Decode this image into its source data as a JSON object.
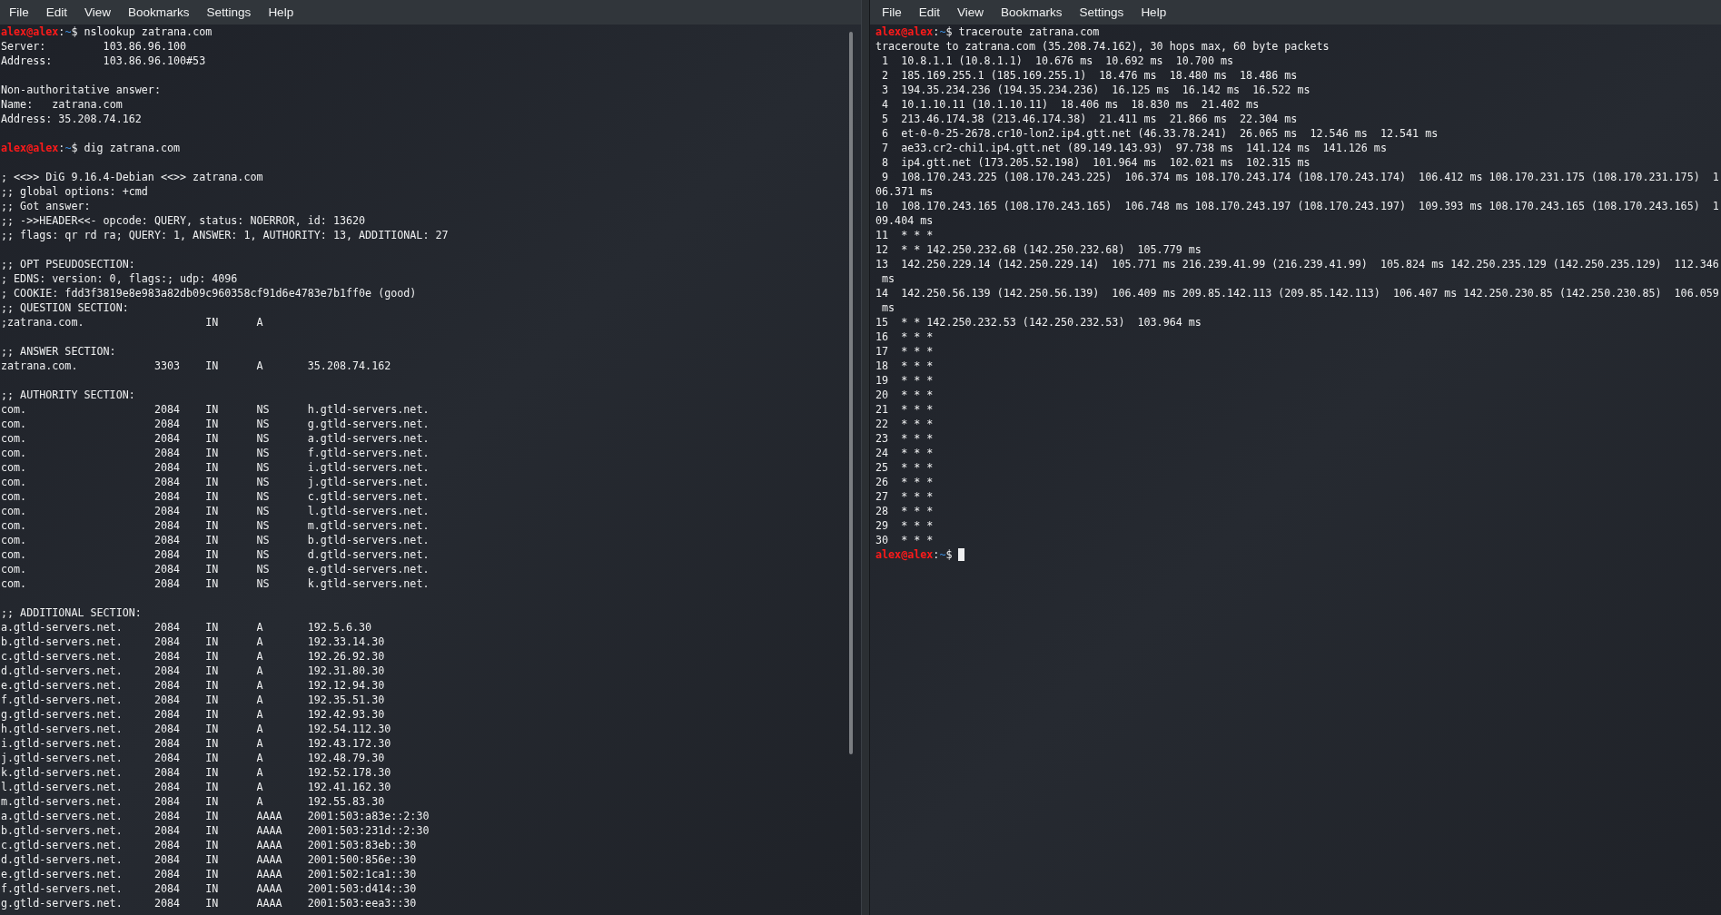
{
  "terminals": [
    {
      "menu": [
        "File",
        "Edit",
        "View",
        "Bookmarks",
        "Settings",
        "Help"
      ],
      "lines": [
        {
          "kind": "prompt",
          "user": "alex@alex",
          "sep": ":",
          "path": "~",
          "sign": "$",
          "command": " nslookup zatrana.com"
        },
        {
          "kind": "output",
          "text": "Server:\t\t103.86.96.100"
        },
        {
          "kind": "output",
          "text": "Address:\t103.86.96.100#53"
        },
        {
          "kind": "blank"
        },
        {
          "kind": "output",
          "text": "Non-authoritative answer:"
        },
        {
          "kind": "output",
          "text": "Name:\tzatrana.com"
        },
        {
          "kind": "output",
          "text": "Address: 35.208.74.162"
        },
        {
          "kind": "blank"
        },
        {
          "kind": "prompt",
          "user": "alex@alex",
          "sep": ":",
          "path": "~",
          "sign": "$",
          "command": " dig zatrana.com"
        },
        {
          "kind": "blank"
        },
        {
          "kind": "output",
          "text": "; <<>> DiG 9.16.4-Debian <<>> zatrana.com"
        },
        {
          "kind": "output",
          "text": ";; global options: +cmd"
        },
        {
          "kind": "output",
          "text": ";; Got answer:"
        },
        {
          "kind": "output",
          "text": ";; ->>HEADER<<- opcode: QUERY, status: NOERROR, id: 13620"
        },
        {
          "kind": "output",
          "text": ";; flags: qr rd ra; QUERY: 1, ANSWER: 1, AUTHORITY: 13, ADDITIONAL: 27"
        },
        {
          "kind": "blank"
        },
        {
          "kind": "output",
          "text": ";; OPT PSEUDOSECTION:"
        },
        {
          "kind": "output",
          "text": "; EDNS: version: 0, flags:; udp: 4096"
        },
        {
          "kind": "output",
          "text": "; COOKIE: fdd3f3819e8e983a82db09c960358cf91d6e4783e7b1ff0e (good)"
        },
        {
          "kind": "output",
          "text": ";; QUESTION SECTION:"
        },
        {
          "kind": "output",
          "text": ";zatrana.com.\t\t\tIN\tA"
        },
        {
          "kind": "blank"
        },
        {
          "kind": "output",
          "text": ";; ANSWER SECTION:"
        },
        {
          "kind": "output",
          "text": "zatrana.com.\t\t3303\tIN\tA\t35.208.74.162"
        },
        {
          "kind": "blank"
        },
        {
          "kind": "output",
          "text": ";; AUTHORITY SECTION:"
        },
        {
          "kind": "output",
          "text": "com.\t\t\t2084\tIN\tNS\th.gtld-servers.net."
        },
        {
          "kind": "output",
          "text": "com.\t\t\t2084\tIN\tNS\tg.gtld-servers.net."
        },
        {
          "kind": "output",
          "text": "com.\t\t\t2084\tIN\tNS\ta.gtld-servers.net."
        },
        {
          "kind": "output",
          "text": "com.\t\t\t2084\tIN\tNS\tf.gtld-servers.net."
        },
        {
          "kind": "output",
          "text": "com.\t\t\t2084\tIN\tNS\ti.gtld-servers.net."
        },
        {
          "kind": "output",
          "text": "com.\t\t\t2084\tIN\tNS\tj.gtld-servers.net."
        },
        {
          "kind": "output",
          "text": "com.\t\t\t2084\tIN\tNS\tc.gtld-servers.net."
        },
        {
          "kind": "output",
          "text": "com.\t\t\t2084\tIN\tNS\tl.gtld-servers.net."
        },
        {
          "kind": "output",
          "text": "com.\t\t\t2084\tIN\tNS\tm.gtld-servers.net."
        },
        {
          "kind": "output",
          "text": "com.\t\t\t2084\tIN\tNS\tb.gtld-servers.net."
        },
        {
          "kind": "output",
          "text": "com.\t\t\t2084\tIN\tNS\td.gtld-servers.net."
        },
        {
          "kind": "output",
          "text": "com.\t\t\t2084\tIN\tNS\te.gtld-servers.net."
        },
        {
          "kind": "output",
          "text": "com.\t\t\t2084\tIN\tNS\tk.gtld-servers.net."
        },
        {
          "kind": "blank"
        },
        {
          "kind": "output",
          "text": ";; ADDITIONAL SECTION:"
        },
        {
          "kind": "output",
          "text": "a.gtld-servers.net.\t2084\tIN\tA\t192.5.6.30"
        },
        {
          "kind": "output",
          "text": "b.gtld-servers.net.\t2084\tIN\tA\t192.33.14.30"
        },
        {
          "kind": "output",
          "text": "c.gtld-servers.net.\t2084\tIN\tA\t192.26.92.30"
        },
        {
          "kind": "output",
          "text": "d.gtld-servers.net.\t2084\tIN\tA\t192.31.80.30"
        },
        {
          "kind": "output",
          "text": "e.gtld-servers.net.\t2084\tIN\tA\t192.12.94.30"
        },
        {
          "kind": "output",
          "text": "f.gtld-servers.net.\t2084\tIN\tA\t192.35.51.30"
        },
        {
          "kind": "output",
          "text": "g.gtld-servers.net.\t2084\tIN\tA\t192.42.93.30"
        },
        {
          "kind": "output",
          "text": "h.gtld-servers.net.\t2084\tIN\tA\t192.54.112.30"
        },
        {
          "kind": "output",
          "text": "i.gtld-servers.net.\t2084\tIN\tA\t192.43.172.30"
        },
        {
          "kind": "output",
          "text": "j.gtld-servers.net.\t2084\tIN\tA\t192.48.79.30"
        },
        {
          "kind": "output",
          "text": "k.gtld-servers.net.\t2084\tIN\tA\t192.52.178.30"
        },
        {
          "kind": "output",
          "text": "l.gtld-servers.net.\t2084\tIN\tA\t192.41.162.30"
        },
        {
          "kind": "output",
          "text": "m.gtld-servers.net.\t2084\tIN\tA\t192.55.83.30"
        },
        {
          "kind": "output",
          "text": "a.gtld-servers.net.\t2084\tIN\tAAAA\t2001:503:a83e::2:30"
        },
        {
          "kind": "output",
          "text": "b.gtld-servers.net.\t2084\tIN\tAAAA\t2001:503:231d::2:30"
        },
        {
          "kind": "output",
          "text": "c.gtld-servers.net.\t2084\tIN\tAAAA\t2001:503:83eb::30"
        },
        {
          "kind": "output",
          "text": "d.gtld-servers.net.\t2084\tIN\tAAAA\t2001:500:856e::30"
        },
        {
          "kind": "output",
          "text": "e.gtld-servers.net.\t2084\tIN\tAAAA\t2001:502:1ca1::30"
        },
        {
          "kind": "output",
          "text": "f.gtld-servers.net.\t2084\tIN\tAAAA\t2001:503:d414::30"
        },
        {
          "kind": "output",
          "text": "g.gtld-servers.net.\t2084\tIN\tAAAA\t2001:503:eea3::30"
        }
      ]
    },
    {
      "menu": [
        "File",
        "Edit",
        "View",
        "Bookmarks",
        "Settings",
        "Help"
      ],
      "lines": [
        {
          "kind": "prompt",
          "user": "alex@alex",
          "sep": ":",
          "path": "~",
          "sign": "$",
          "command": " traceroute zatrana.com"
        },
        {
          "kind": "output",
          "text": "traceroute to zatrana.com (35.208.74.162), 30 hops max, 60 byte packets"
        },
        {
          "kind": "output",
          "text": " 1  10.8.1.1 (10.8.1.1)  10.676 ms  10.692 ms  10.700 ms"
        },
        {
          "kind": "output",
          "text": " 2  185.169.255.1 (185.169.255.1)  18.476 ms  18.480 ms  18.486 ms"
        },
        {
          "kind": "output",
          "text": " 3  194.35.234.236 (194.35.234.236)  16.125 ms  16.142 ms  16.522 ms"
        },
        {
          "kind": "output",
          "text": " 4  10.1.10.11 (10.1.10.11)  18.406 ms  18.830 ms  21.402 ms"
        },
        {
          "kind": "output",
          "text": " 5  213.46.174.38 (213.46.174.38)  21.411 ms  21.866 ms  22.304 ms"
        },
        {
          "kind": "output",
          "text": " 6  et-0-0-25-2678.cr10-lon2.ip4.gtt.net (46.33.78.241)  26.065 ms  12.546 ms  12.541 ms"
        },
        {
          "kind": "output",
          "text": " 7  ae33.cr2-chi1.ip4.gtt.net (89.149.143.93)  97.738 ms  141.124 ms  141.126 ms"
        },
        {
          "kind": "output",
          "text": " 8  ip4.gtt.net (173.205.52.198)  101.964 ms  102.021 ms  102.315 ms"
        },
        {
          "kind": "output",
          "text": " 9  108.170.243.225 (108.170.243.225)  106.374 ms 108.170.243.174 (108.170.243.174)  106.412 ms 108.170.231.175 (108.170.231.175)  1"
        },
        {
          "kind": "output",
          "text": "06.371 ms"
        },
        {
          "kind": "output",
          "text": "10  108.170.243.165 (108.170.243.165)  106.748 ms 108.170.243.197 (108.170.243.197)  109.393 ms 108.170.243.165 (108.170.243.165)  1"
        },
        {
          "kind": "output",
          "text": "09.404 ms"
        },
        {
          "kind": "output",
          "text": "11  * * *"
        },
        {
          "kind": "output",
          "text": "12  * * 142.250.232.68 (142.250.232.68)  105.779 ms"
        },
        {
          "kind": "output",
          "text": "13  142.250.229.14 (142.250.229.14)  105.771 ms 216.239.41.99 (216.239.41.99)  105.824 ms 142.250.235.129 (142.250.235.129)  112.346"
        },
        {
          "kind": "output",
          "text": " ms"
        },
        {
          "kind": "output",
          "text": "14  142.250.56.139 (142.250.56.139)  106.409 ms 209.85.142.113 (209.85.142.113)  106.407 ms 142.250.230.85 (142.250.230.85)  106.059"
        },
        {
          "kind": "output",
          "text": " ms"
        },
        {
          "kind": "output",
          "text": "15  * * 142.250.232.53 (142.250.232.53)  103.964 ms"
        },
        {
          "kind": "output",
          "text": "16  * * *"
        },
        {
          "kind": "output",
          "text": "17  * * *"
        },
        {
          "kind": "output",
          "text": "18  * * *"
        },
        {
          "kind": "output",
          "text": "19  * * *"
        },
        {
          "kind": "output",
          "text": "20  * * *"
        },
        {
          "kind": "output",
          "text": "21  * * *"
        },
        {
          "kind": "output",
          "text": "22  * * *"
        },
        {
          "kind": "output",
          "text": "23  * * *"
        },
        {
          "kind": "output",
          "text": "24  * * *"
        },
        {
          "kind": "output",
          "text": "25  * * *"
        },
        {
          "kind": "output",
          "text": "26  * * *"
        },
        {
          "kind": "output",
          "text": "27  * * *"
        },
        {
          "kind": "output",
          "text": "28  * * *"
        },
        {
          "kind": "output",
          "text": "29  * * *"
        },
        {
          "kind": "output",
          "text": "30  * * *"
        },
        {
          "kind": "prompt",
          "user": "alex@alex",
          "sep": ":",
          "path": "~",
          "sign": "$",
          "cursor": true
        }
      ]
    }
  ]
}
